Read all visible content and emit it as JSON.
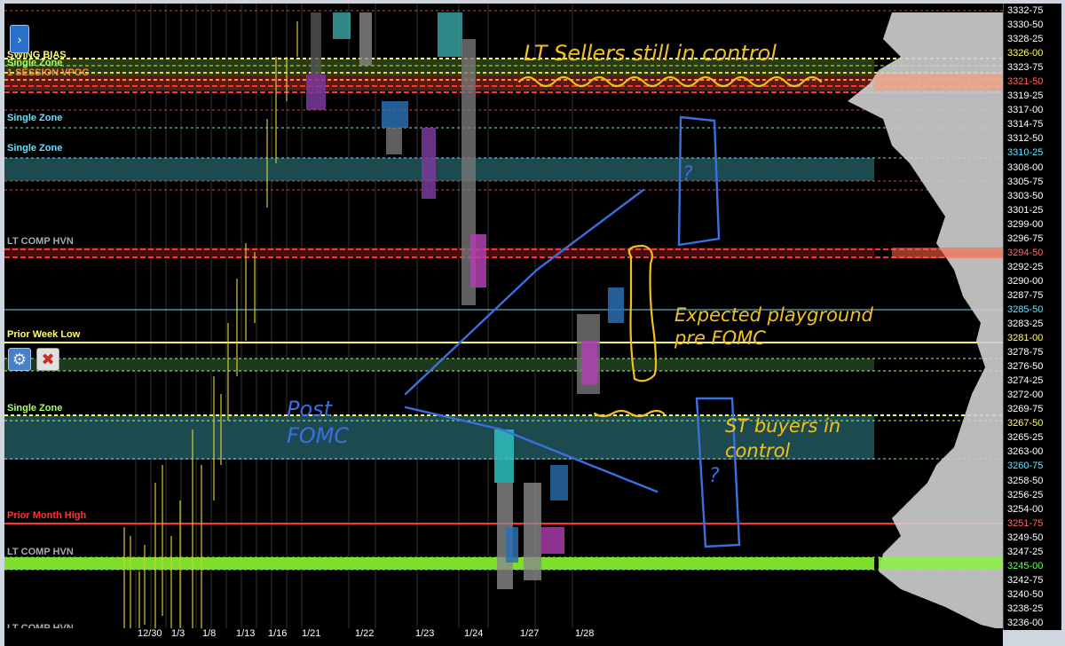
{
  "price_axis": [
    {
      "label": "3332-75",
      "color": "#ffffff"
    },
    {
      "label": "3330-50",
      "color": "#ffffff"
    },
    {
      "label": "3328-25",
      "color": "#ffffff"
    },
    {
      "label": "3326-00",
      "color": "#ffff66"
    },
    {
      "label": "3323-75",
      "color": "#ffffff"
    },
    {
      "label": "3321-50",
      "color": "#ff6666"
    },
    {
      "label": "3319-25",
      "color": "#ffffff"
    },
    {
      "label": "3317-00",
      "color": "#ffffff"
    },
    {
      "label": "3314-75",
      "color": "#ffffff"
    },
    {
      "label": "3312-50",
      "color": "#ffffff"
    },
    {
      "label": "3310-25",
      "color": "#66e0ff"
    },
    {
      "label": "3308-00",
      "color": "#ffffff"
    },
    {
      "label": "3305-75",
      "color": "#ffffff"
    },
    {
      "label": "3303-50",
      "color": "#ffffff"
    },
    {
      "label": "3301-25",
      "color": "#ffffff"
    },
    {
      "label": "3299-00",
      "color": "#ffffff"
    },
    {
      "label": "3296-75",
      "color": "#ffffff"
    },
    {
      "label": "3294-50",
      "color": "#ff6666"
    },
    {
      "label": "3292-25",
      "color": "#ffffff"
    },
    {
      "label": "3290-00",
      "color": "#ffffff"
    },
    {
      "label": "3287-75",
      "color": "#ffffff"
    },
    {
      "label": "3285-50",
      "color": "#66e0ff"
    },
    {
      "label": "3283-25",
      "color": "#ffffff"
    },
    {
      "label": "3281-00",
      "color": "#ffff66"
    },
    {
      "label": "3278-75",
      "color": "#ffffff"
    },
    {
      "label": "3276-50",
      "color": "#ffffff"
    },
    {
      "label": "3274-25",
      "color": "#ffffff"
    },
    {
      "label": "3272-00",
      "color": "#ffffff"
    },
    {
      "label": "3269-75",
      "color": "#ffffff"
    },
    {
      "label": "3267-50",
      "color": "#ffff66"
    },
    {
      "label": "3265-25",
      "color": "#ffffff"
    },
    {
      "label": "3263-00",
      "color": "#ffffff"
    },
    {
      "label": "3260-75",
      "color": "#66e0ff"
    },
    {
      "label": "3258-50",
      "color": "#ffffff"
    },
    {
      "label": "3256-25",
      "color": "#ffffff"
    },
    {
      "label": "3254-00",
      "color": "#ffffff"
    },
    {
      "label": "3251-75",
      "color": "#ff6666"
    },
    {
      "label": "3249-50",
      "color": "#ffffff"
    },
    {
      "label": "3247-25",
      "color": "#ffffff"
    },
    {
      "label": "3245-00",
      "color": "#66ff66"
    },
    {
      "label": "3242-75",
      "color": "#ffffff"
    },
    {
      "label": "3240-50",
      "color": "#ffffff"
    },
    {
      "label": "3238-25",
      "color": "#ffffff"
    },
    {
      "label": "3236-00",
      "color": "#ffffff"
    }
  ],
  "levels": [
    {
      "label": "SWING BIAS",
      "color": "#ffff66"
    },
    {
      "label": "Single Zone",
      "color": "#aaff66"
    },
    {
      "label": "1 SESSION VPOC",
      "color": "#ff8844"
    },
    {
      "label": "Single Zone",
      "color": "#66e0ff"
    },
    {
      "label": "Single Zone",
      "color": "#66e0ff"
    },
    {
      "label": "LT COMP HVN",
      "color": "#aaaaaa"
    },
    {
      "label": "Prior Week Low",
      "color": "#ffff66"
    },
    {
      "label": "Single Zone",
      "color": "#aaff66"
    },
    {
      "label": "Prior Month High",
      "color": "#ff3333"
    },
    {
      "label": "LT COMP HVN",
      "color": "#aaaaaa"
    },
    {
      "label": "LT COMP HVN",
      "color": "#aaaaaa"
    }
  ],
  "date_labels": [
    "12/30",
    "1/3",
    "1/8",
    "1/13",
    "1/16",
    "1/21",
    "1/22",
    "1/23",
    "1/24",
    "1/27",
    "1/28"
  ],
  "annotations": {
    "top": "LT Sellers still in control",
    "middle_right": "Expected playground pre FOMC",
    "left": "Post FOMC",
    "bottom_right": "ST buyers in control",
    "question_1": "?",
    "question_2": "?"
  },
  "toolbar": {
    "expand_glyph": "›",
    "settings_icon": "gear-icon",
    "close_icon": "close-icon",
    "settings_glyph": "⚙",
    "close_glyph": "✖"
  },
  "colors": {
    "background": "#000000",
    "annotation_yellow": "#f2c21b",
    "annotation_blue": "#3a6fe0",
    "zone_teal": "#1d4a4f",
    "hvn_green": "#7ddf2a"
  }
}
